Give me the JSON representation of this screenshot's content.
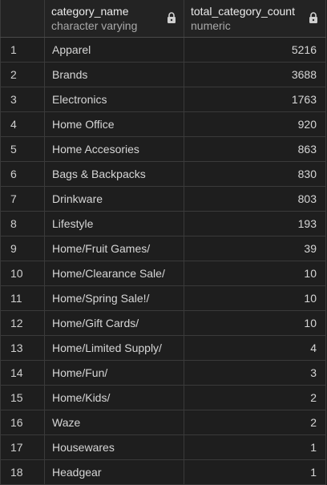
{
  "columns": [
    {
      "name": "category_name",
      "type": "character varying",
      "lock_icon": "lock-icon"
    },
    {
      "name": "total_category_count",
      "type": "numeric",
      "lock_icon": "lock-icon"
    }
  ],
  "rows": [
    {
      "idx": "1",
      "name": "Apparel",
      "count": "5216"
    },
    {
      "idx": "2",
      "name": "Brands",
      "count": "3688"
    },
    {
      "idx": "3",
      "name": "Electronics",
      "count": "1763"
    },
    {
      "idx": "4",
      "name": "Home Office",
      "count": "920"
    },
    {
      "idx": "5",
      "name": "Home Accesories",
      "count": "863"
    },
    {
      "idx": "6",
      "name": "Bags & Backpacks",
      "count": "830"
    },
    {
      "idx": "7",
      "name": "Drinkware",
      "count": "803"
    },
    {
      "idx": "8",
      "name": "Lifestyle",
      "count": "193"
    },
    {
      "idx": "9",
      "name": "Home/Fruit Games/",
      "count": "39"
    },
    {
      "idx": "10",
      "name": "Home/Clearance Sale/",
      "count": "10"
    },
    {
      "idx": "11",
      "name": "Home/Spring Sale!/",
      "count": "10"
    },
    {
      "idx": "12",
      "name": "Home/Gift Cards/",
      "count": "10"
    },
    {
      "idx": "13",
      "name": "Home/Limited Supply/",
      "count": "4"
    },
    {
      "idx": "14",
      "name": "Home/Fun/",
      "count": "3"
    },
    {
      "idx": "15",
      "name": "Home/Kids/",
      "count": "2"
    },
    {
      "idx": "16",
      "name": "Waze",
      "count": "2"
    },
    {
      "idx": "17",
      "name": "Housewares",
      "count": "1"
    },
    {
      "idx": "18",
      "name": "Headgear",
      "count": "1"
    }
  ]
}
